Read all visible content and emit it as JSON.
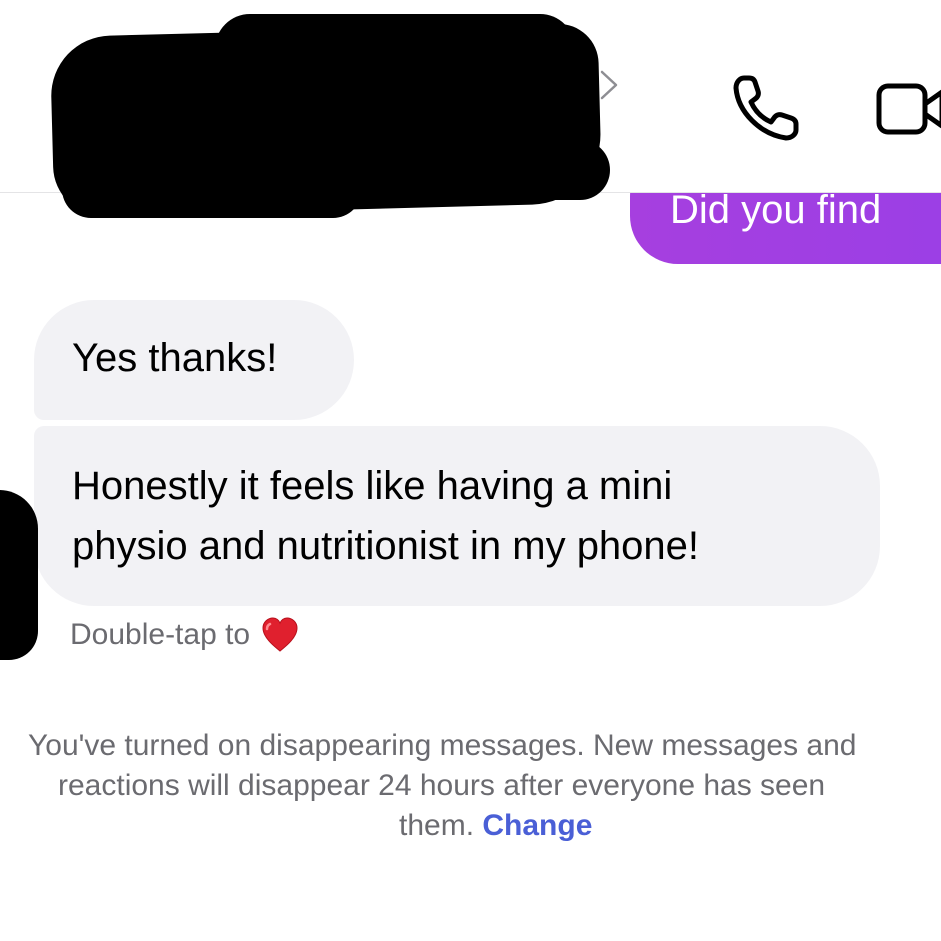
{
  "header": {
    "contact_name": "",
    "icons": {
      "chevron": "chevron-right-icon",
      "call": "phone-icon",
      "video": "video-camera-icon"
    }
  },
  "messages": {
    "outgoing_partial": "Did you find",
    "incoming": [
      {
        "text": "Yes thanks!"
      },
      {
        "lines": [
          "Honestly it feels like having a mini",
          "physio and nutritionist in my phone!"
        ]
      }
    ],
    "reaction_hint": "Double-tap to",
    "reaction_icon": "heart-icon",
    "reaction_color": "#e0202e"
  },
  "system_note": {
    "lines": [
      "You've turned on disappearing messages. New messages and",
      "reactions will disappear 24 hours after everyone has seen",
      "them."
    ],
    "change_link": "Change",
    "link_color": "#4a5fd6"
  },
  "colors": {
    "outgoing_bubble": "#a13ee3",
    "incoming_bubble": "#f2f2f5",
    "secondary_text": "#6b6b70"
  }
}
